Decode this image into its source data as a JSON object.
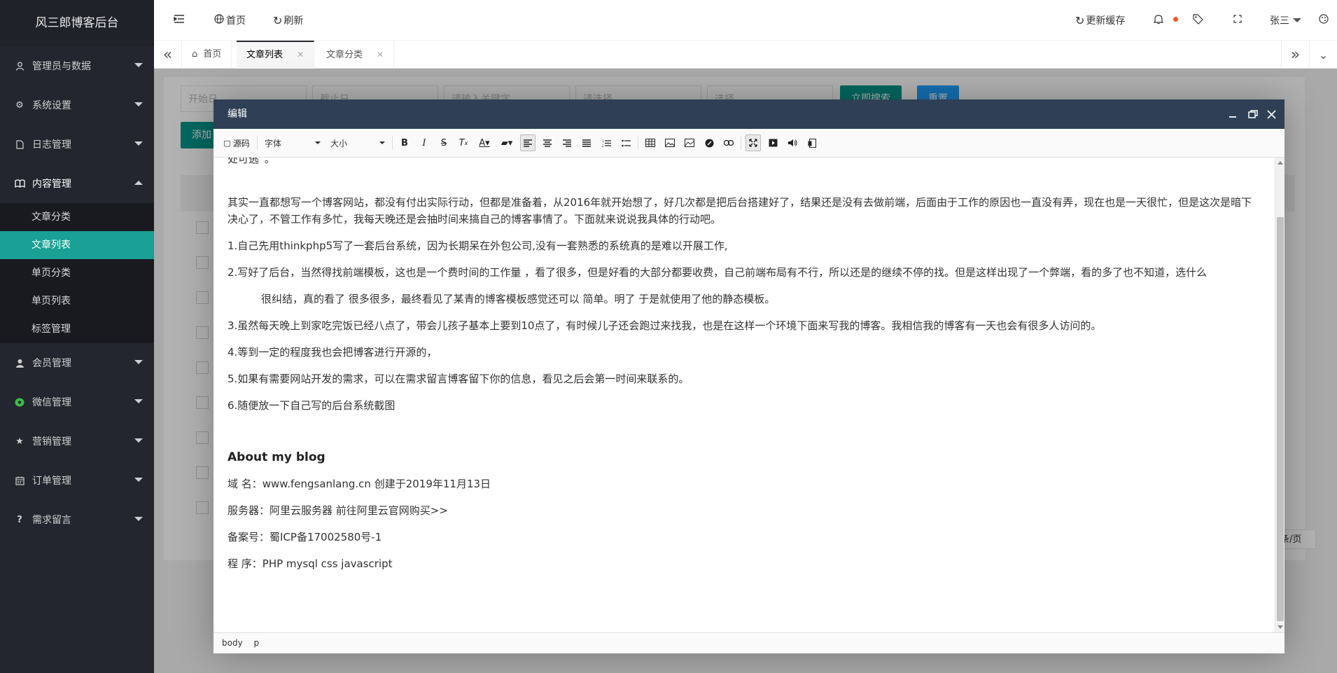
{
  "app": {
    "title": "风三郎博客后台"
  },
  "sidebar": {
    "groups": [
      {
        "label": "管理员与数据",
        "icon": "user-icon"
      },
      {
        "label": "系统设置",
        "icon": "gear-icon"
      },
      {
        "label": "日志管理",
        "icon": "file-icon"
      },
      {
        "label": "内容管理",
        "icon": "book-icon",
        "open": true
      },
      {
        "label": "会员管理",
        "icon": "member-icon"
      },
      {
        "label": "微信管理",
        "icon": "wechat-icon"
      },
      {
        "label": "营销管理",
        "icon": "star-icon"
      },
      {
        "label": "订单管理",
        "icon": "calendar-icon"
      },
      {
        "label": "需求留言",
        "icon": "question-icon"
      }
    ],
    "content_items": [
      "文章分类",
      "文章列表",
      "单页分类",
      "单页列表",
      "标签管理"
    ],
    "active_item": "文章列表"
  },
  "header": {
    "home_label": "首页",
    "refresh_label": "刷新",
    "update_cache_label": "更新缓存",
    "user_name": "张三"
  },
  "tabs": [
    {
      "label": "首页"
    },
    {
      "label": "文章列表",
      "active": true
    },
    {
      "label": "文章分类"
    }
  ],
  "background": {
    "start_date_placeholder": "开始日",
    "end_date_placeholder": "截止日",
    "keyword_placeholder": "请输入关键字",
    "select1_placeholder": "请选择",
    "select2_placeholder": "选择",
    "search_button": "立即搜索",
    "reset_button": "重置",
    "add_button": "添加",
    "page_size_label": "条/页"
  },
  "modal": {
    "title": "编辑",
    "toolbar": {
      "source_label": "源码",
      "font_label": "字体",
      "size_label": "大小"
    },
    "content": {
      "p0": "处可逃”。",
      "p1": "其实一直都想写一个博客网站，都没有付出实际行动，但都是准备着，从2016年就开始想了，好几次都是把后台搭建好了，结果还是没有去做前端，后面由于工作的原因也一直没有弄，现在也是一天很忙，但是这次是暗下决心了，不管工作有多忙，我每天晚还是会抽时间来搞自己的博客事情了。下面就来说说我具体的行动吧。",
      "p2": "1.自己先用thinkphp5写了一套后台系统，因为长期呆在外包公司,没有一套熟悉的系统真的是难以开展工作,",
      "p3": "2.写好了后台，当然得找前端模板，这也是一个费时间的工作量 ，看了很多，但是好看的大部分都要收费，自己前端布局有不行，所以还是的继续不停的找。但是这样出现了一个弊端，看的多了也不知道，选什么",
      "p4": "很纠结，真的看了 很多很多，最终看见了某青的博客模板感觉还可以 简单。明了 于是就使用了他的静态模板。",
      "p5": "3.虽然每天晚上到家吃完饭已经八点了，带会儿孩子基本上要到10点了，有时候儿子还会跑过来找我，也是在这样一个环境下面来写我的博客。我相信我的博客有一天也会有很多人访问的。",
      "p6": "4.等到一定的程度我也会把博客进行开源的，",
      "p7": "5.如果有需要网站开发的需求，可以在需求留言博客留下你的信息，看见之后会第一时间来联系的。",
      "p8": "6.随便放一下自己写的后台系统截图",
      "about_title": "About my blog",
      "a1": "域 名：www.fengsanlang.cn  创建于2019年11月13日",
      "a2": "服务器：阿里云服务器  前往阿里云官网购买>>",
      "a3": "备案号：蜀ICP备17002580号-1",
      "a4": "程 序：PHP  mysql css javascript"
    },
    "status_path": [
      "body",
      "p"
    ]
  }
}
